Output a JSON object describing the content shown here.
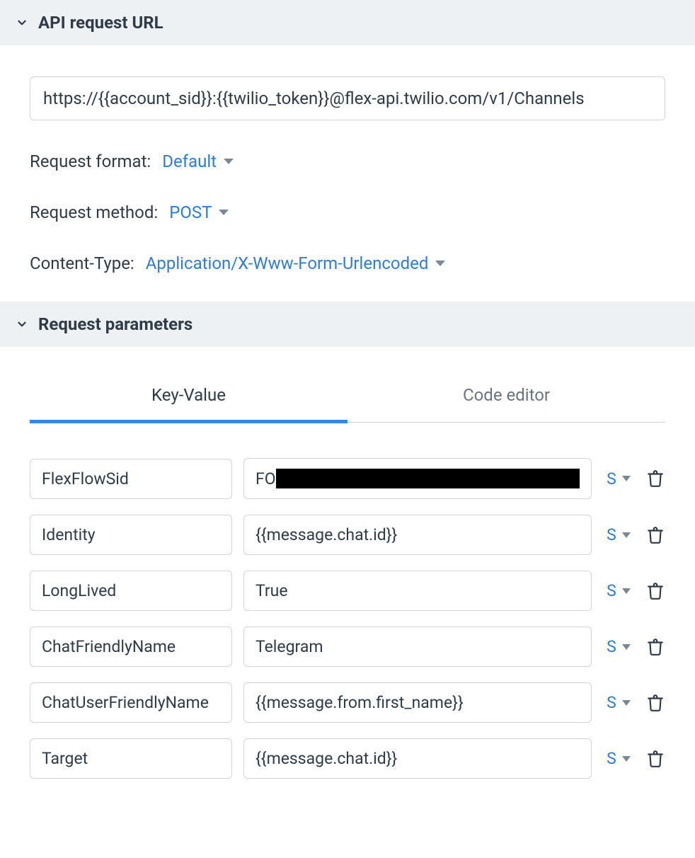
{
  "sections": {
    "api_url": {
      "title": "API request URL"
    },
    "request_params": {
      "title": "Request parameters"
    }
  },
  "url": "https://{{account_sid}}:{{twilio_token}}@flex-api.twilio.com/v1/Channels",
  "request_format": {
    "label": "Request format:",
    "value": "Default"
  },
  "request_method": {
    "label": "Request method:",
    "value": "POST"
  },
  "content_type": {
    "label": "Content-Type:",
    "value": "Application/X-Www-Form-Urlencoded"
  },
  "tabs": {
    "key_value": "Key-Value",
    "code_editor": "Code editor"
  },
  "type_indicator": "S",
  "params": [
    {
      "key": "FlexFlowSid",
      "value_prefix": "FO",
      "redacted": true
    },
    {
      "key": "Identity",
      "value": "{{message.chat.id}}"
    },
    {
      "key": "LongLived",
      "value": "True"
    },
    {
      "key": "ChatFriendlyName",
      "value": "Telegram"
    },
    {
      "key": "ChatUserFriendlyName",
      "value": "{{message.from.first_name}}"
    },
    {
      "key": "Target",
      "value": "{{message.chat.id}}"
    }
  ]
}
